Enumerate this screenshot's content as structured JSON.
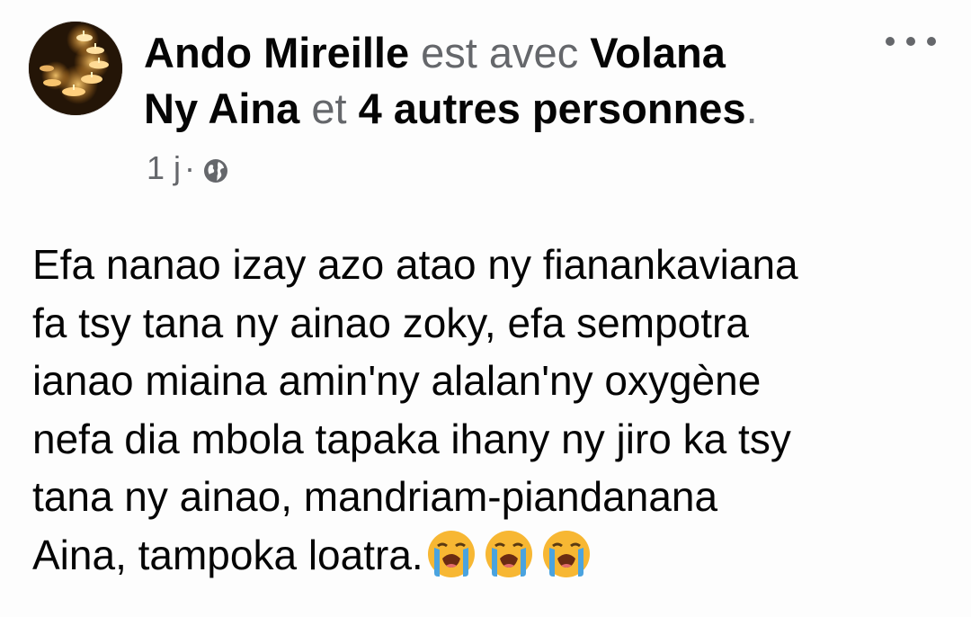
{
  "post": {
    "author": "Ando Mireille",
    "connector": "est avec",
    "tagged_person_line1": "Volana",
    "tagged_person_line2": "Ny Aina",
    "and_word": "et",
    "others_link": "4 autres personnes",
    "end_punct": ".",
    "timestamp": "1 j",
    "separator": "·",
    "privacy_icon": "globe-icon",
    "more_icon": "more-options-icon",
    "body_lines": [
      "Efa nanao izay azo atao ny fianankaviana",
      "fa tsy tana ny ainao zoky, efa sempotra",
      "ianao miaina amin'ny alalan'ny oxygène",
      "nefa dia mbola tapaka ihany ny jiro ka tsy",
      "tana ny ainao, mandriam-piandanana",
      "Aina, tampoka loatra."
    ],
    "emojis": [
      "loudly-crying-face",
      "loudly-crying-face",
      "loudly-crying-face"
    ]
  },
  "colors": {
    "primary_text": "#050505",
    "secondary_text": "#65676b",
    "emoji_yellow": "#f7b733",
    "emoji_tears": "#4aa3df"
  }
}
